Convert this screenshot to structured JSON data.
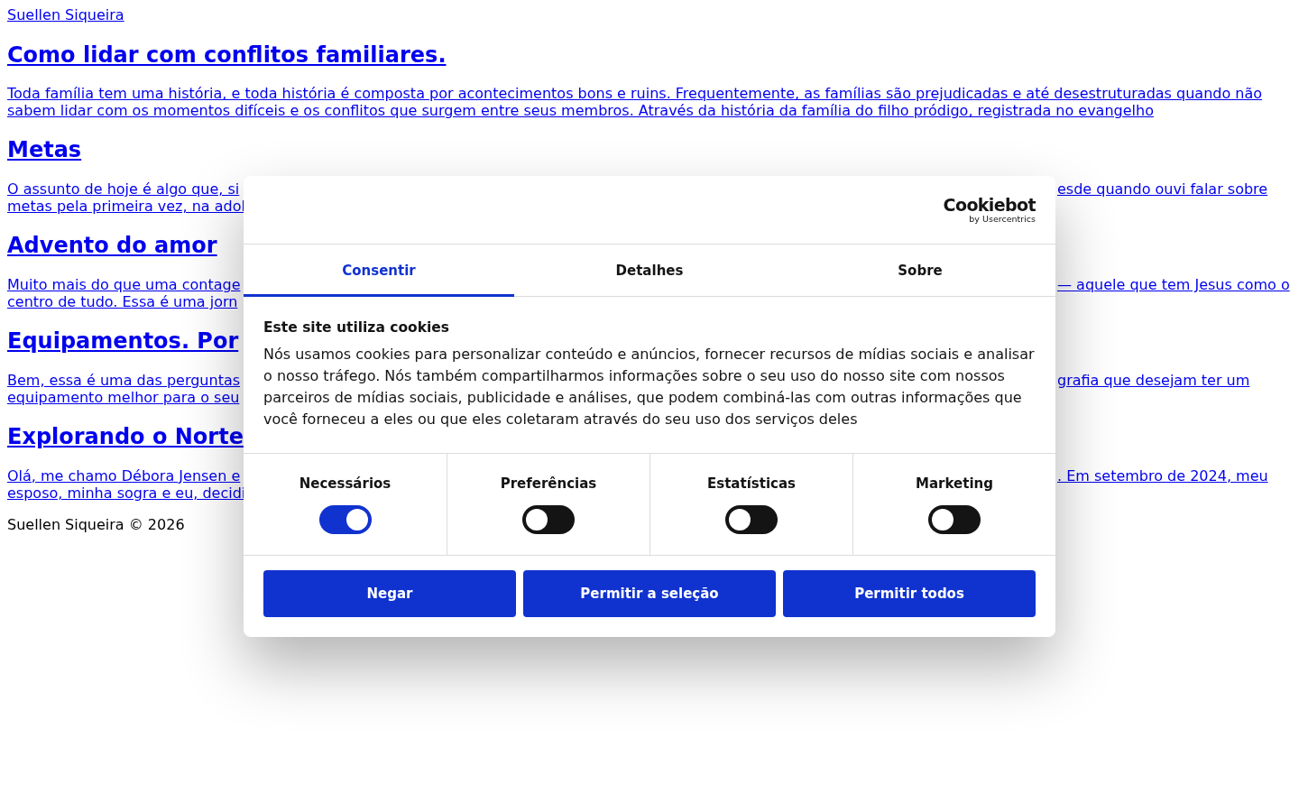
{
  "page": {
    "site_title": "Suellen Siqueira",
    "posts": [
      {
        "title": "Como lidar com conflitos familiares.",
        "excerpt": "Toda família tem uma história, e toda história é composta por acontecimentos bons e ruins. Frequentemente, as famílias são prejudicadas e até desestruturadas quando não sabem lidar com os momentos difíceis e os conflitos que surgem entre seus membros. Através da história da família do filho pródigo, registrada no evangelho"
      },
      {
        "title": "Metas",
        "visible_lines": [
          {
            "left": "O assunto de hoje é algo que, si",
            "right": "esde quando ouvi falar sobre"
          },
          {
            "left": "metas pela primeira vez, na adol"
          }
        ]
      },
      {
        "title": "Advento do amor",
        "visible_lines": [
          {
            "left": "Muito mais do que uma contage",
            "right": "— aquele que tem Jesus como o"
          },
          {
            "left": "centro de tudo. Essa é uma jorn"
          }
        ]
      },
      {
        "title": "Equipamentos. Por",
        "visible_lines": [
          {
            "left": "Bem, essa é uma das perguntas",
            "right": "grafia que desejam ter um"
          },
          {
            "left": "equipamento melhor para o seu"
          }
        ]
      },
      {
        "title": "Explorando o Norte",
        "visible_lines": [
          {
            "left": "Olá, me chamo Débora Jensen e",
            "right": ". Em setembro de 2024, meu"
          },
          {
            "left": "esposo, minha sogra e eu, decidi"
          }
        ]
      }
    ],
    "footer": "Suellen Siqueira © 2026"
  },
  "cookie_dialog": {
    "logo": {
      "name": "Cookiebot",
      "byline": "by Usercentrics"
    },
    "tabs": [
      {
        "label": "Consentir",
        "selected": true
      },
      {
        "label": "Detalhes",
        "selected": false
      },
      {
        "label": "Sobre",
        "selected": false
      }
    ],
    "heading": "Este site utiliza cookies",
    "text": "Nós usamos cookies para personalizar conteúdo e anúncios, fornecer recursos de mídias sociais e analisar o nosso tráfego. Nós também compartilharmos informações sobre o seu uso do nosso site com nossos parceiros de mídias sociais, publicidade e análises, que podem combiná-las com outras informações que você forneceu a eles ou que eles coletaram através do seu uso dos serviços deles",
    "categories": [
      {
        "label": "Necessários",
        "on": true
      },
      {
        "label": "Preferências",
        "on": false
      },
      {
        "label": "Estatísticas",
        "on": false
      },
      {
        "label": "Marketing",
        "on": false
      }
    ],
    "buttons": [
      "Negar",
      "Permitir a seleção",
      "Permitir todos"
    ]
  }
}
